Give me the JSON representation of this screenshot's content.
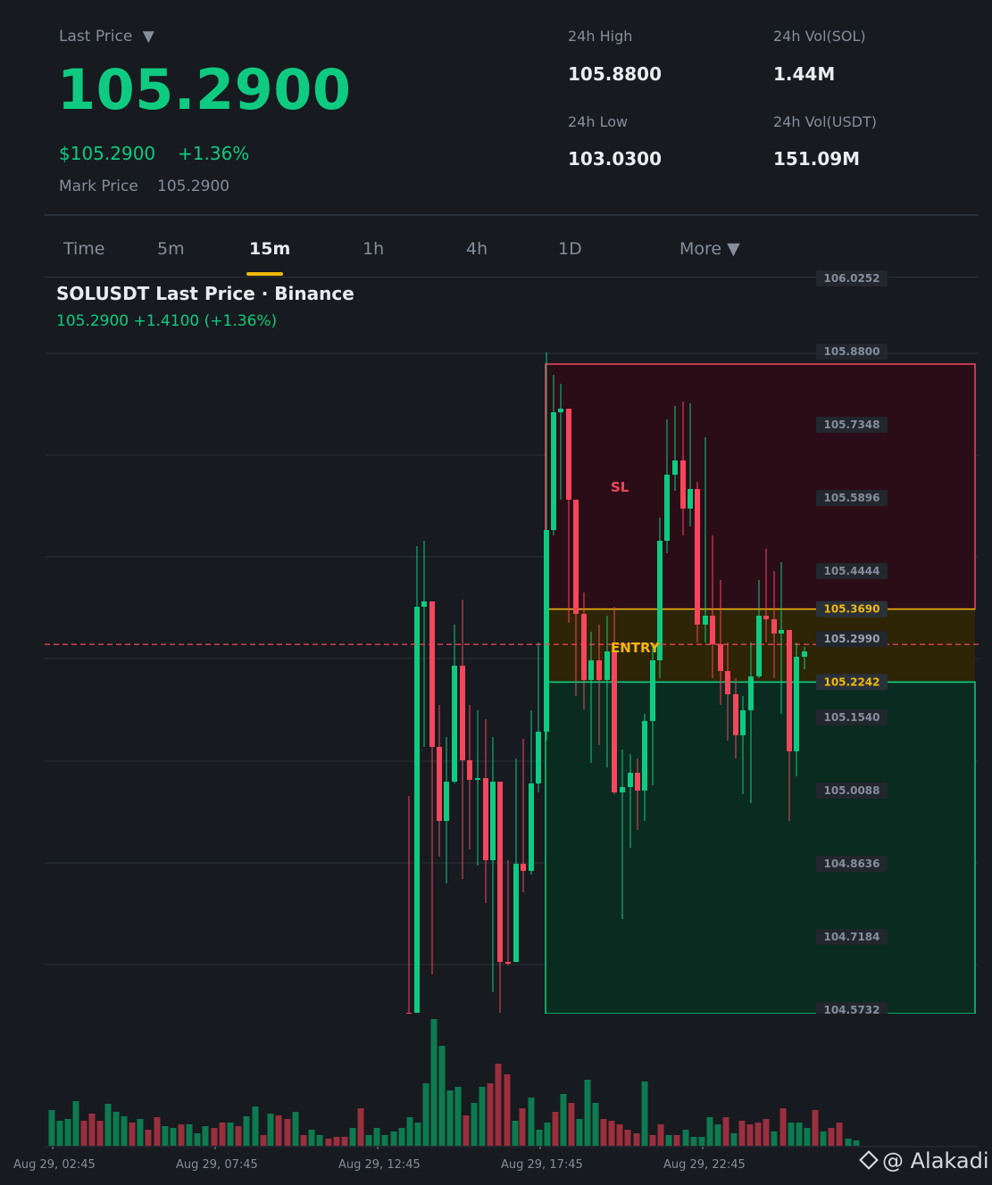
{
  "header": {
    "last_price_label": "Last Price",
    "dropdown_glyph": "▼",
    "last_price": "105.2900",
    "usd_price": "$105.2900",
    "pct_change": "+1.36%",
    "mark_price_label": "Mark Price",
    "mark_price": "105.2900"
  },
  "stats": {
    "high_label": "24h High",
    "high_value": "105.8800",
    "low_label": "24h Low",
    "low_value": "103.0300",
    "vol_sol_label": "24h Vol(SOL)",
    "vol_sol_value": "1.44M",
    "vol_usdt_label": "24h Vol(USDT)",
    "vol_usdt_value": "151.09M"
  },
  "tabs": [
    {
      "label": "Time",
      "active": false
    },
    {
      "label": "5m",
      "active": false
    },
    {
      "label": "15m",
      "active": true
    },
    {
      "label": "1h",
      "active": false
    },
    {
      "label": "4h",
      "active": false
    },
    {
      "label": "1D",
      "active": false
    },
    {
      "label": "More ▼",
      "active": false
    }
  ],
  "chart": {
    "title": "SOLUSDT Last Price · Binance",
    "subtitle": "105.2900  +1.4100 (+1.36%)",
    "price_axis": [
      "106.0252",
      "105.8800",
      "105.7348",
      "105.5896",
      "105.4444",
      "105.2992",
      "105.1540",
      "105.0088",
      "104.8636",
      "104.7184",
      "104.5732"
    ],
    "sl_label": "SL",
    "entry_label": "ENTRY",
    "sl_level": "105.3690",
    "tp_level": "105.2242",
    "current_price": "105.2990",
    "time_labels": [
      "Aug 29, 02:45",
      "Aug 29, 07:45",
      "Aug 29, 12:45",
      "Aug 29, 17:45",
      "Aug 29, 22:45"
    ]
  },
  "colors": {
    "up": "#0ecb81",
    "down": "#f6465d",
    "accent": "#f0b90b",
    "bg": "#171a1f"
  },
  "watermark": "@ Alakadi"
}
